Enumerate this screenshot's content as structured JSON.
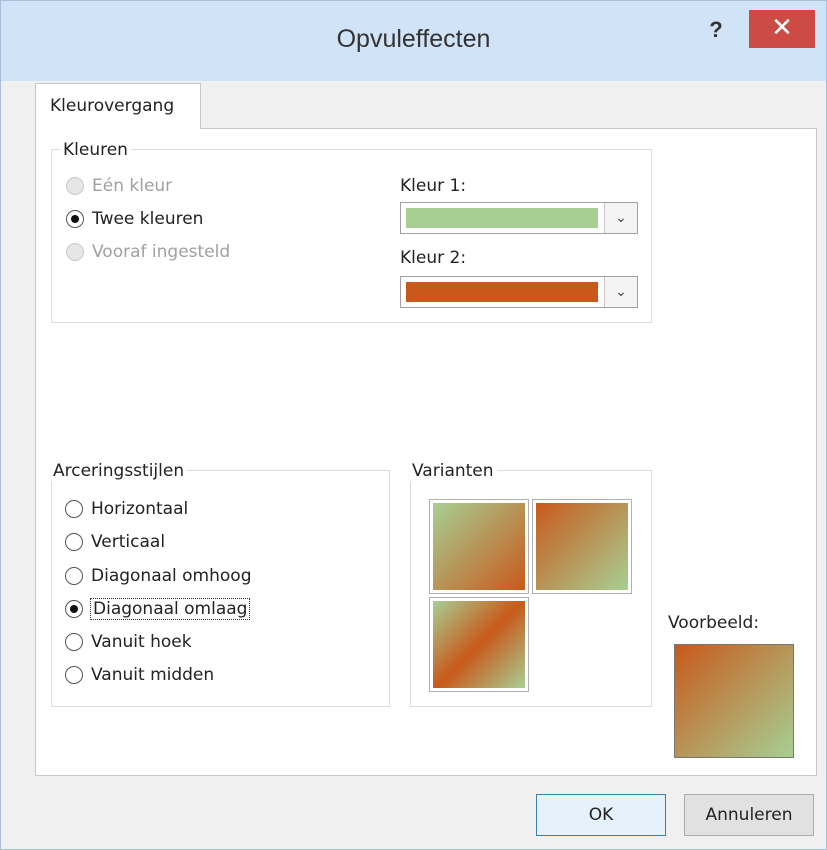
{
  "window": {
    "title": "Opvuleffecten",
    "help_label": "?",
    "close_label": "✕"
  },
  "tab": {
    "label": "Kleurovergang"
  },
  "colors_group": {
    "legend": "Kleuren",
    "options": [
      {
        "label": "Eén kleur",
        "checked": false,
        "disabled": true
      },
      {
        "label": "Twee kleuren",
        "checked": true,
        "disabled": false
      },
      {
        "label": "Vooraf ingesteld",
        "checked": false,
        "disabled": true
      }
    ],
    "color1_label": "Kleur 1:",
    "color1_value": "#a7cf94",
    "color2_label": "Kleur 2:",
    "color2_value": "#c8591b",
    "dropdown_arrow": "⌄"
  },
  "shading_group": {
    "legend": "Arceringsstijlen",
    "options": [
      {
        "label": "Horizontaal",
        "checked": false
      },
      {
        "label": "Verticaal",
        "checked": false
      },
      {
        "label": "Diagonaal omhoog",
        "checked": false
      },
      {
        "label": "Diagonaal omlaag",
        "checked": true
      },
      {
        "label": "Vanuit hoek",
        "checked": false
      },
      {
        "label": "Vanuit midden",
        "checked": false
      }
    ]
  },
  "variants_group": {
    "legend": "Varianten"
  },
  "preview": {
    "label": "Voorbeeld:"
  },
  "buttons": {
    "ok": "OK",
    "cancel": "Annuleren"
  }
}
